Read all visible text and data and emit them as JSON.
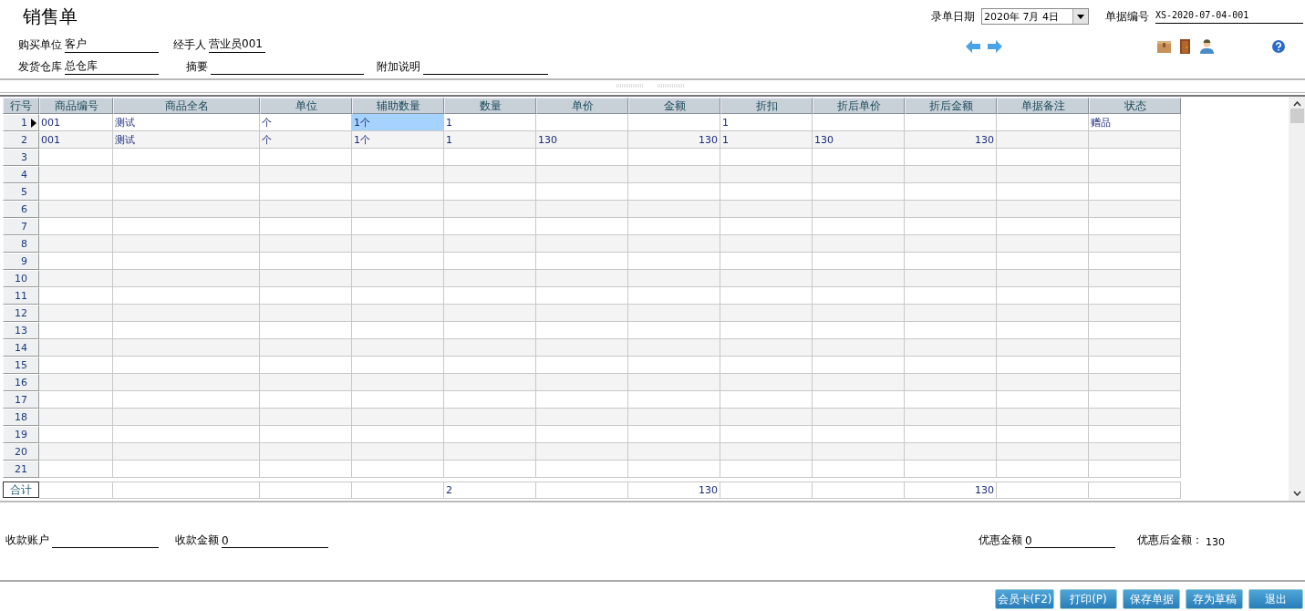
{
  "title": "销售单",
  "header_fields": [
    {
      "label": "购买单位",
      "value": "客户"
    },
    {
      "label": "经手人",
      "value": "营业员001"
    },
    {
      "label": "发货仓库",
      "value": "总仓库"
    },
    {
      "label": "摘要"
    },
    {
      "label": "附加说明"
    }
  ],
  "date": {
    "label": "录单日期",
    "value": "2020年  7月  4日"
  },
  "doc_number": {
    "label": "单据编号",
    "value": "XS-2020-07-04-001"
  },
  "columns": [
    {
      "label": "行号"
    },
    {
      "label": "商品编号",
      "kind": "text"
    },
    {
      "label": "商品全名",
      "kind": "text"
    },
    {
      "label": "单位",
      "kind": "text"
    },
    {
      "label": "辅助数量",
      "kind": "text"
    },
    {
      "label": "数量",
      "kind": "text"
    },
    {
      "label": "单价",
      "kind": "text"
    },
    {
      "label": "金额",
      "kind": "amount"
    },
    {
      "label": "折扣",
      "kind": "text"
    },
    {
      "label": "折后单价",
      "kind": "text"
    },
    {
      "label": "折后金额",
      "kind": "amount"
    },
    {
      "label": "单据备注",
      "kind": "text"
    },
    {
      "label": "状态",
      "kind": "text"
    }
  ],
  "rows": [
    {
      "no": "1",
      "current": true,
      "cells": [
        {
          "text": "001",
          "selected": false
        },
        {
          "text": "测试",
          "selected": false
        },
        {
          "text": "个",
          "selected": false
        },
        {
          "text": "1个",
          "selected": true
        },
        {
          "text": "1",
          "selected": false
        },
        {
          "selected": false
        },
        {
          "selected": false
        },
        {
          "text": "1",
          "selected": false
        },
        {
          "selected": false
        },
        {
          "selected": false
        },
        {
          "selected": false
        },
        {
          "text": "赠品",
          "selected": false
        }
      ]
    },
    {
      "no": "2",
      "current": false,
      "cells": [
        {
          "text": "001",
          "selected": false
        },
        {
          "text": "测试",
          "selected": false
        },
        {
          "text": "个",
          "selected": false
        },
        {
          "text": "1个",
          "selected": false
        },
        {
          "text": "1",
          "selected": false
        },
        {
          "text": "130",
          "selected": false
        },
        {
          "text": "130",
          "selected": false
        },
        {
          "text": "1",
          "selected": false
        },
        {
          "text": "130",
          "selected": false
        },
        {
          "text": "130",
          "selected": false
        },
        {
          "selected": false
        },
        {
          "selected": false
        }
      ]
    },
    {
      "no": "3",
      "current": false
    },
    {
      "no": "4",
      "current": false
    },
    {
      "no": "5",
      "current": false
    },
    {
      "no": "6",
      "current": false
    },
    {
      "no": "7",
      "current": false
    },
    {
      "no": "8",
      "current": false
    },
    {
      "no": "9",
      "current": false
    },
    {
      "no": "10",
      "current": false
    },
    {
      "no": "11",
      "current": false
    },
    {
      "no": "12",
      "current": false
    },
    {
      "no": "13",
      "current": false
    },
    {
      "no": "14",
      "current": false
    },
    {
      "no": "15",
      "current": false
    },
    {
      "no": "16",
      "current": false
    },
    {
      "no": "17",
      "current": false
    },
    {
      "no": "18",
      "current": false
    },
    {
      "no": "19",
      "current": false
    },
    {
      "no": "20",
      "current": false
    },
    {
      "no": "21",
      "current": false
    }
  ],
  "totals": {
    "label": "合计",
    "cells": [
      {
        "kind": "blank"
      },
      {
        "kind": "blank"
      },
      {
        "kind": "blank"
      },
      {
        "kind": "blank"
      },
      {
        "kind": "value",
        "text": "2"
      },
      {
        "kind": "blank"
      },
      {
        "kind": "value",
        "text": "130"
      },
      {
        "kind": "blank"
      },
      {
        "kind": "blank"
      },
      {
        "kind": "value",
        "text": "130"
      },
      {
        "kind": "blank"
      },
      {
        "kind": "blank"
      }
    ]
  },
  "footer_fields": [
    {
      "label": "收款账户"
    },
    {
      "label": "收款金额",
      "value": "0"
    },
    {
      "label": "优惠金额",
      "value": "0"
    }
  ],
  "after_discount": {
    "label": "优惠后金额：",
    "value": "130"
  },
  "buttons": [
    "会员卡(F2)",
    "打印(P)",
    "保存单据",
    "存为草稿",
    "退出"
  ]
}
